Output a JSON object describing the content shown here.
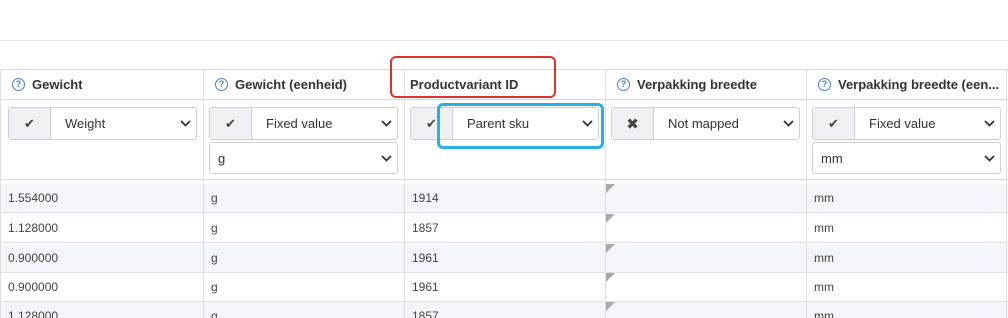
{
  "columns": [
    {
      "header": "Gewicht",
      "selects": [
        {
          "has_check": true,
          "check_icon": "check-icon",
          "value": "Weight"
        }
      ]
    },
    {
      "header": "Gewicht (eenheid)",
      "selects": [
        {
          "has_check": true,
          "check_icon": "check-icon",
          "value": "Fixed value"
        },
        {
          "has_check": false,
          "value": "g"
        }
      ]
    },
    {
      "header": "Productvariant ID",
      "selects": [
        {
          "has_check": true,
          "check_icon": "check-icon",
          "value": "Parent sku"
        }
      ]
    },
    {
      "header": "Verpakking breedte",
      "selects": [
        {
          "has_check": true,
          "check_icon": "x-icon",
          "value": "Not mapped"
        }
      ]
    },
    {
      "header": "Verpakking breedte (een...",
      "selects": [
        {
          "has_check": true,
          "check_icon": "check-icon",
          "value": "Fixed value"
        },
        {
          "has_check": false,
          "value": "mm"
        }
      ]
    }
  ],
  "rows": [
    [
      "1.554000",
      "g",
      "1914",
      "",
      "mm"
    ],
    [
      "1.128000",
      "g",
      "1857",
      "",
      "mm"
    ],
    [
      "0.900000",
      "g",
      "1961",
      "",
      "mm"
    ],
    [
      "0.900000",
      "g",
      "1961",
      "",
      "mm"
    ],
    [
      "1.128000",
      "g",
      "1857",
      "",
      "mm"
    ]
  ],
  "colors": {
    "help_icon": "#4a7fc1",
    "highlight_red": "#e03030",
    "highlight_blue": "#29aee6",
    "row_alt": "#f2f5f9"
  }
}
